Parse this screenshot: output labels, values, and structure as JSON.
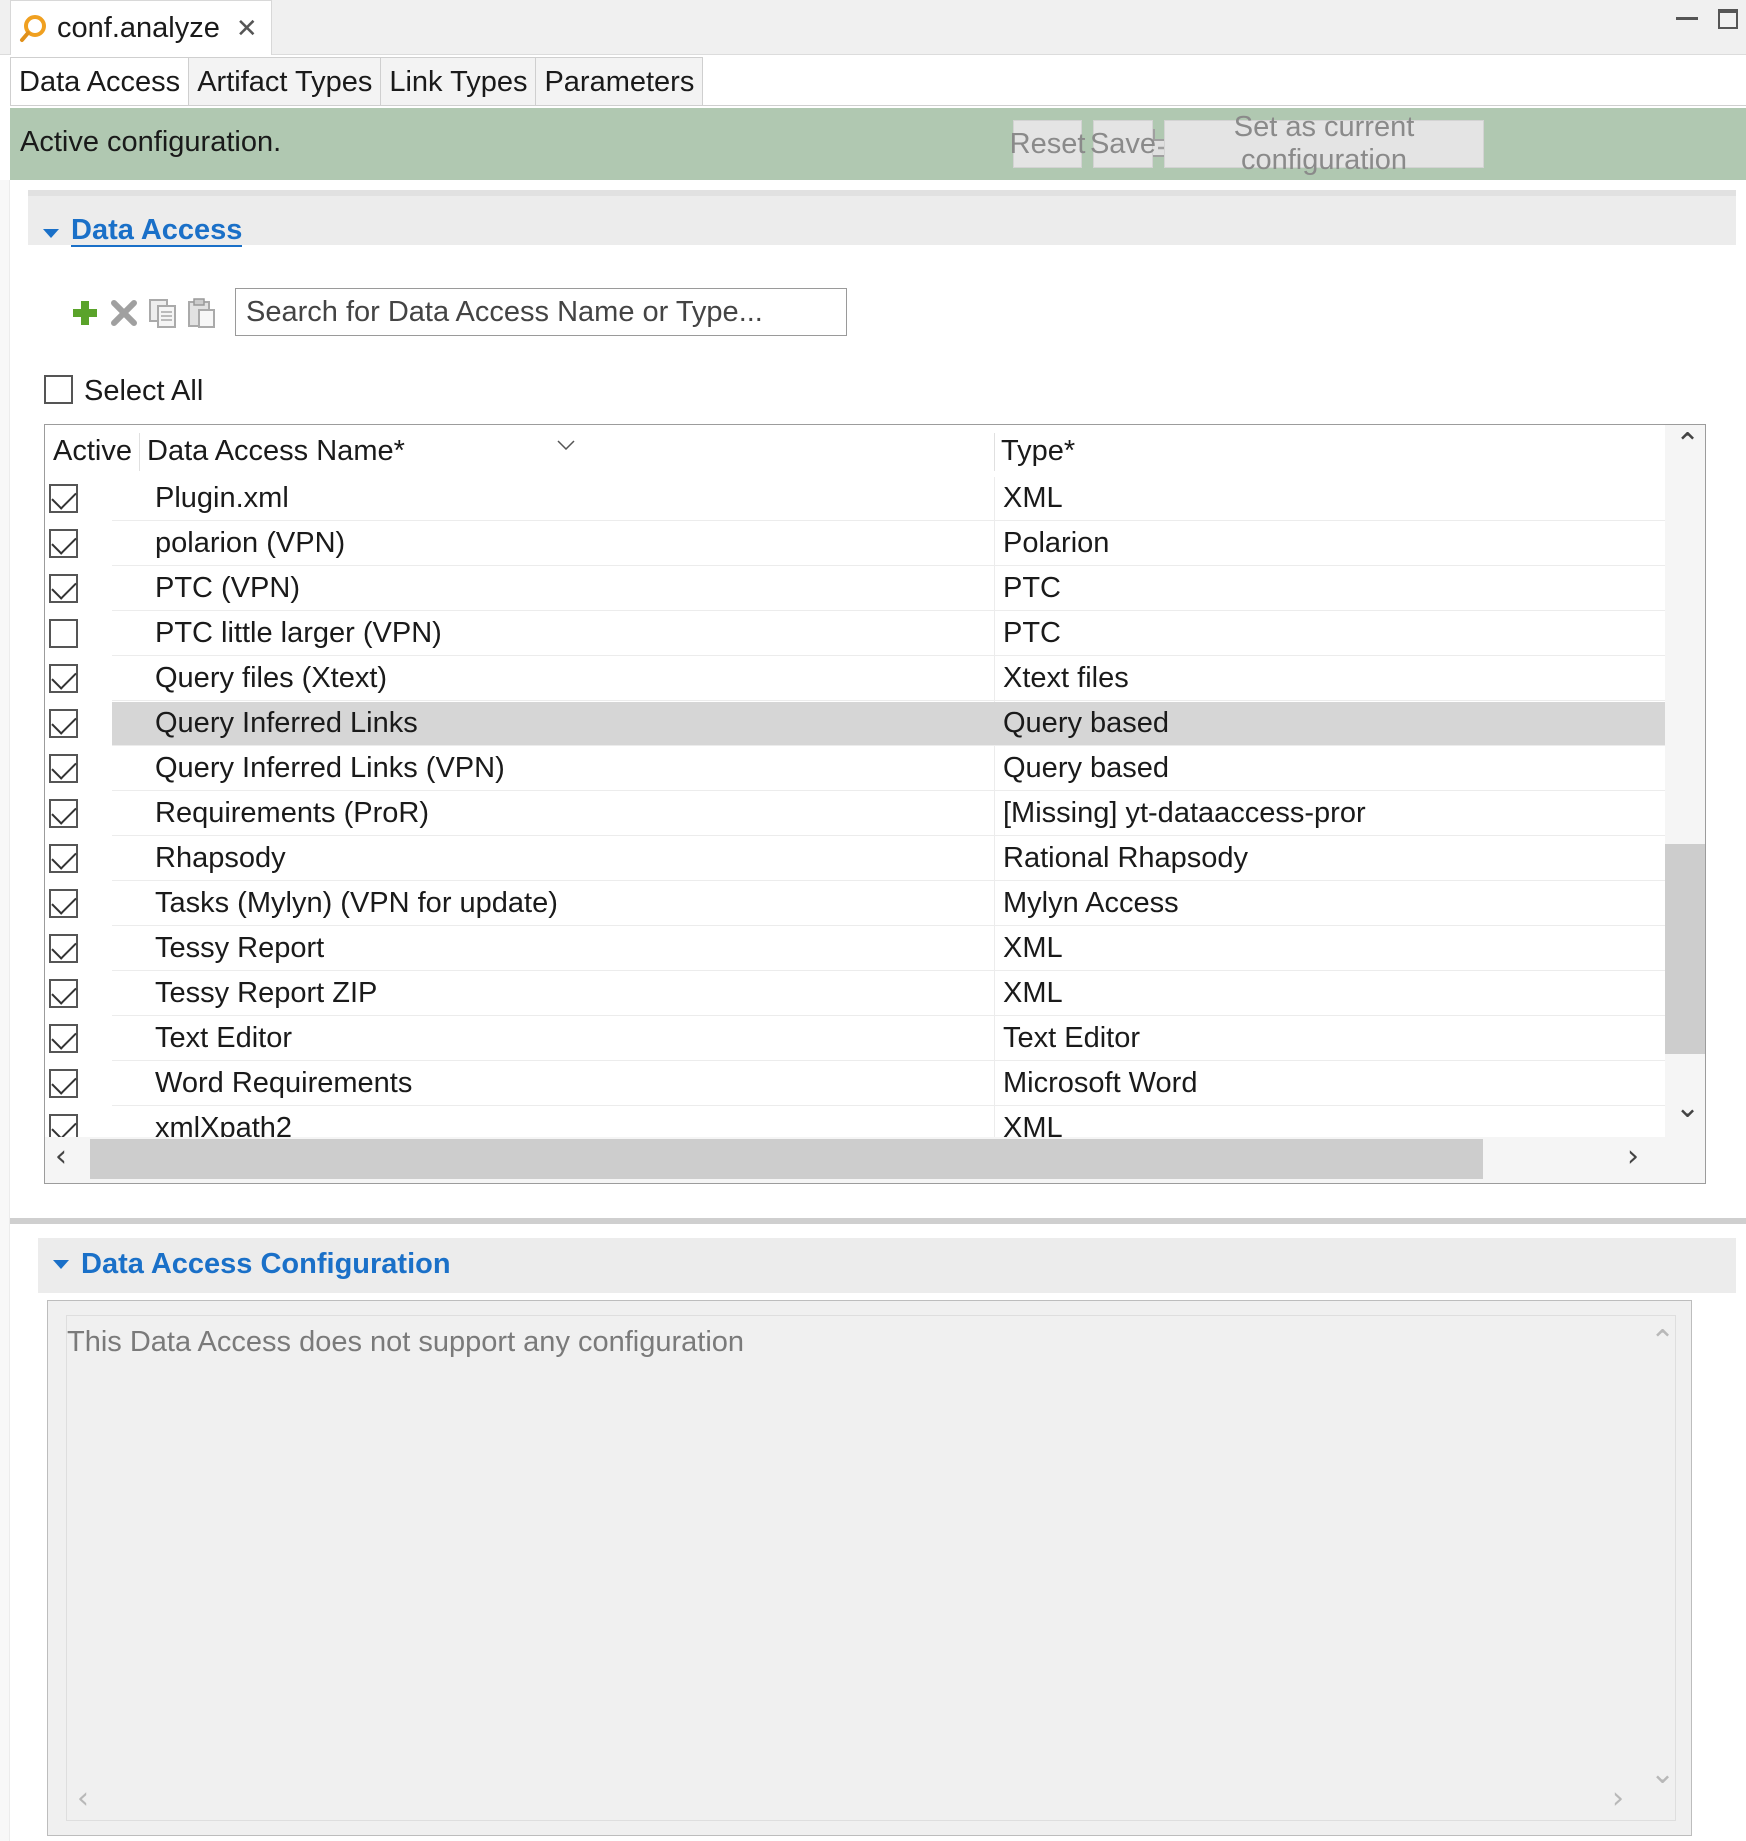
{
  "editor": {
    "file_name": "conf.analyze",
    "close_glyph": "✕"
  },
  "page_tabs": [
    "Data Access",
    "Artifact Types",
    "Link Types",
    "Parameters"
  ],
  "status": {
    "text": "Active configuration.",
    "reset_label": "Reset",
    "save_label": "Save",
    "set_current_label": "Set as current configuration"
  },
  "data_access_section": {
    "title": "Data Access",
    "search_placeholder": "Search for Data Access Name or Type...",
    "select_all_label": "Select All",
    "select_all_checked": false,
    "columns": {
      "active": "Active",
      "name": "Data Access Name*",
      "type": "Type*"
    },
    "rows": [
      {
        "active": true,
        "name": "Plugin.xml",
        "type": "XML"
      },
      {
        "active": true,
        "name": "polarion (VPN)",
        "type": "Polarion"
      },
      {
        "active": true,
        "name": "PTC (VPN)",
        "type": "PTC"
      },
      {
        "active": false,
        "name": "PTC little larger (VPN)",
        "type": "PTC"
      },
      {
        "active": true,
        "name": "Query files (Xtext)",
        "type": "Xtext files"
      },
      {
        "active": true,
        "name": "Query Inferred Links",
        "type": "Query based",
        "selected": true
      },
      {
        "active": true,
        "name": "Query Inferred Links (VPN)",
        "type": "Query based"
      },
      {
        "active": true,
        "name": "Requirements (ProR)",
        "type": "[Missing] yt-dataaccess-pror"
      },
      {
        "active": true,
        "name": "Rhapsody",
        "type": "Rational Rhapsody"
      },
      {
        "active": true,
        "name": "Tasks (Mylyn) (VPN for update)",
        "type": "Mylyn Access"
      },
      {
        "active": true,
        "name": "Tessy Report",
        "type": "XML"
      },
      {
        "active": true,
        "name": "Tessy Report ZIP",
        "type": "XML"
      },
      {
        "active": true,
        "name": "Text Editor",
        "type": "Text Editor"
      },
      {
        "active": true,
        "name": "Word Requirements",
        "type": "Microsoft Word"
      },
      {
        "active": true,
        "name": "xmlXpath2",
        "type": "XML"
      }
    ]
  },
  "config_section": {
    "title": "Data Access Configuration",
    "message": "This Data Access does not support any configuration"
  },
  "colors": {
    "status_band": "#b0c8b1",
    "section_title": "#1a70c8",
    "selected_row": "#d6d6d6",
    "add_icon": "#5aa32a"
  }
}
